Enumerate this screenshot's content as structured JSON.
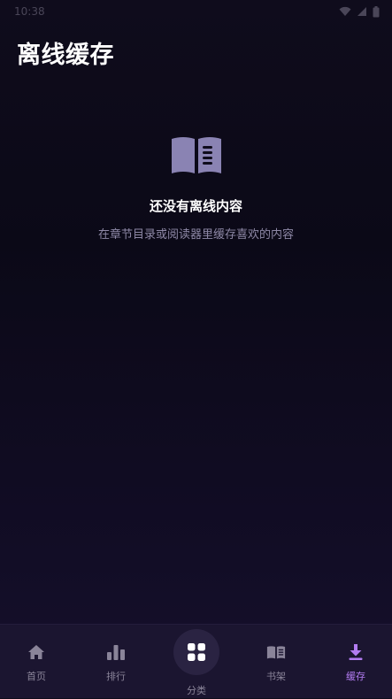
{
  "status_bar": {
    "time": "10:38"
  },
  "page": {
    "title": "离线缓存"
  },
  "empty_state": {
    "icon": "open-book-icon",
    "title": "还没有离线内容",
    "subtitle": "在章节目录或阅读器里缓存喜欢的内容"
  },
  "bottom_nav": {
    "items": [
      {
        "label": "首页",
        "icon": "home-icon"
      },
      {
        "label": "排行",
        "icon": "bar-chart-icon"
      },
      {
        "label": "分类",
        "icon": "grid-icon"
      },
      {
        "label": "书架",
        "icon": "bookshelf-icon"
      },
      {
        "label": "缓存",
        "icon": "download-icon"
      }
    ],
    "active_index": 4
  },
  "colors": {
    "accent": "#b37cf2",
    "icon_muted": "#8a8499",
    "book_icon": "#8a83b3",
    "background": "#0b0917",
    "nav_background": "#1b1530"
  }
}
